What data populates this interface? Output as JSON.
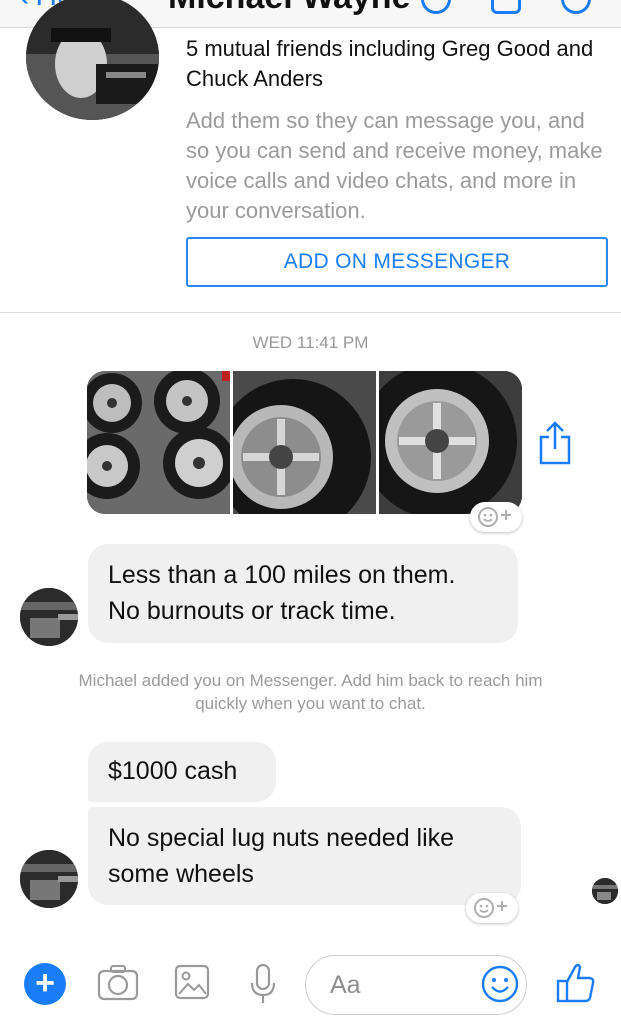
{
  "nav": {
    "back_label": "Home",
    "title": "Michael Wayne"
  },
  "profile": {
    "mutual_friends": "5 mutual friends including Greg Good and Chuck Anders",
    "add_text": "Add them so they can message you, and so you can send and receive money, make voice calls and video chats, and more in your conversation.",
    "add_button": "ADD ON MESSENGER"
  },
  "conversation": {
    "timestamp": "WED 11:41 PM",
    "photos": [
      "tire-photo-1",
      "tire-photo-2",
      "tire-photo-3"
    ],
    "messages": [
      {
        "line1": "Less than a 100 miles on them.",
        "line2": "No burnouts or track time."
      },
      {
        "line1": "$1000 cash"
      },
      {
        "line1": "No special lug nuts needed like",
        "line2": "some wheels"
      }
    ],
    "notice_line1": "Michael added you on Messenger. Add him back to reach him",
    "notice_line2": "quickly when you want to chat."
  },
  "composer": {
    "placeholder": "Aa",
    "plus_symbol": "+"
  },
  "colors": {
    "accent": "#1a7df7",
    "bubble": "#f1f0f0",
    "muted_text": "#9b9b9b"
  },
  "icons": [
    "back-chevron-icon",
    "phone-icon",
    "video-icon",
    "info-icon",
    "share-icon",
    "add-reaction-icon",
    "camera-icon",
    "gallery-icon",
    "microphone-icon",
    "emoji-icon",
    "like-icon"
  ]
}
